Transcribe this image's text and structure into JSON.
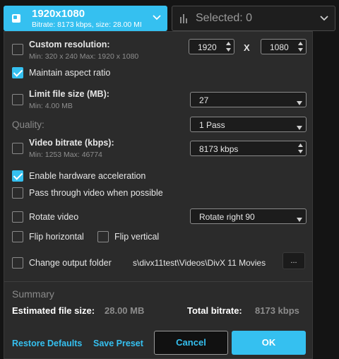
{
  "preset": {
    "title": "1920x1080",
    "subtitle": "Bitrate: 8173 kbps, size: 28.00 MI",
    "icon": "film-icon"
  },
  "selected": {
    "label": "Selected: 0",
    "icon": "bars-icon"
  },
  "custom_resolution": {
    "label": "Custom resolution:",
    "hint": "Min: 320 x 240 Max: 1920 x 1080",
    "checked": false,
    "width": "1920",
    "separator": "X",
    "height": "1080"
  },
  "maintain_aspect": {
    "label": "Maintain aspect ratio",
    "checked": true
  },
  "limit_file_size": {
    "label": "Limit file size (MB):",
    "hint": "Min: 4.00 MB",
    "checked": false,
    "value": "27"
  },
  "quality": {
    "label": "Quality:",
    "value": "1 Pass"
  },
  "video_bitrate": {
    "label": "Video bitrate (kbps):",
    "hint": "Min: 1253 Max: 46774",
    "checked": false,
    "value": "8173 kbps"
  },
  "hw_accel": {
    "label": "Enable hardware acceleration",
    "checked": true
  },
  "pass_through": {
    "label": "Pass through video when possible",
    "checked": false
  },
  "rotate": {
    "label": "Rotate video",
    "checked": false,
    "value": "Rotate right 90"
  },
  "flip_h": {
    "label": "Flip horizontal",
    "checked": false
  },
  "flip_v": {
    "label": "Flip vertical",
    "checked": false
  },
  "output_folder": {
    "label": "Change output folder",
    "checked": false,
    "path": "s\\divx11test\\Videos\\DivX 11 Movies",
    "browse_label": "..."
  },
  "summary": {
    "title": "Summary",
    "est_size_label": "Estimated file size:",
    "est_size_value": "28.00 MB",
    "total_bitrate_label": "Total bitrate:",
    "total_bitrate_value": "8173 kbps"
  },
  "footer": {
    "restore_label": "Restore Defaults",
    "save_label": "Save Preset",
    "cancel_label": "Cancel",
    "ok_label": "OK"
  },
  "colors": {
    "accent": "#35c0f0",
    "panel": "#2b2b2b",
    "background": "#141414"
  }
}
